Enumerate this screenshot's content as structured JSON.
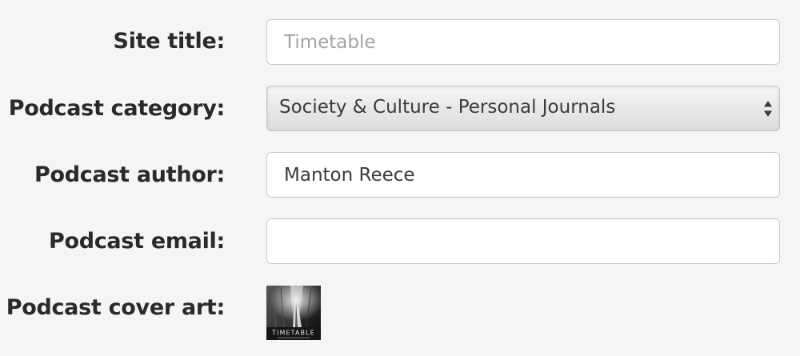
{
  "form": {
    "site_title": {
      "label": "Site title:",
      "value": "",
      "placeholder": "Timetable"
    },
    "podcast_category": {
      "label": "Podcast category:",
      "selected": "Society & Culture - Personal Journals"
    },
    "podcast_author": {
      "label": "Podcast author:",
      "value": "Manton Reece"
    },
    "podcast_email": {
      "label": "Podcast email:",
      "value": ""
    },
    "podcast_cover_art": {
      "label": "Podcast cover art:",
      "title_text": "TIMETABLE"
    }
  },
  "colors": {
    "label_text": "#2a2a2a",
    "field_text": "#3b3b3b",
    "placeholder_text": "#a3a3a3",
    "field_border": "#c8c8c8",
    "background": "#f5f5f5"
  },
  "icons": {
    "select_arrows": "up-down-arrows-icon"
  }
}
